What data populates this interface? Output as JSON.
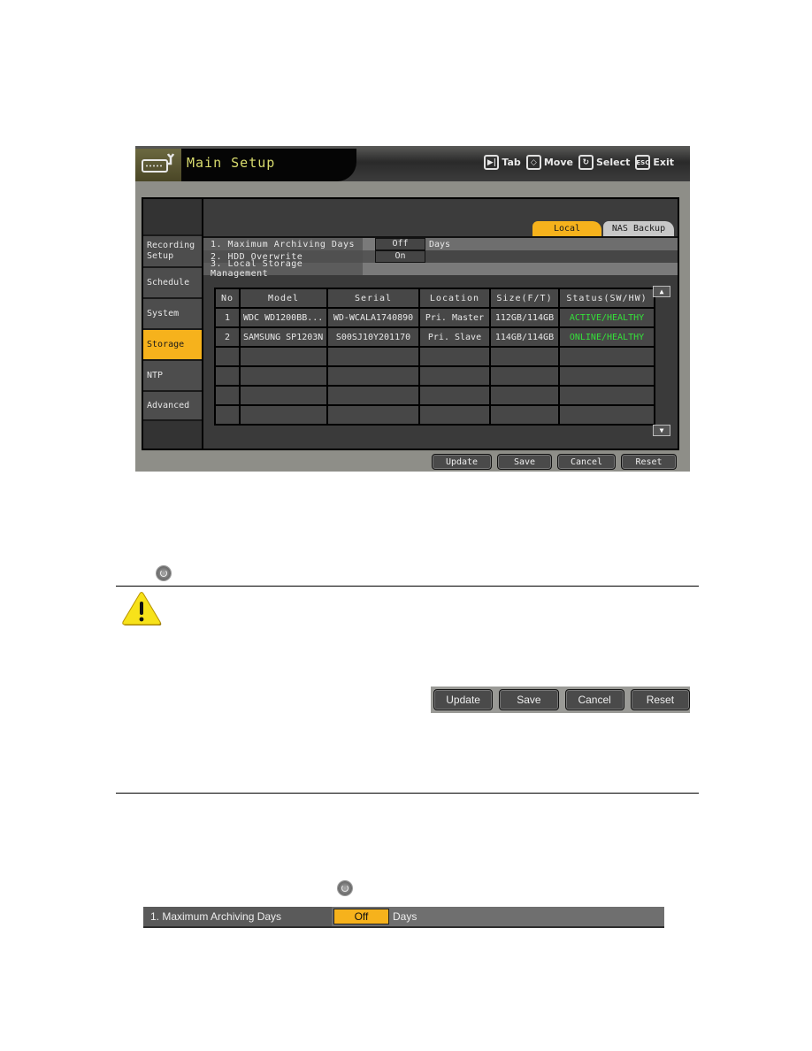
{
  "window": {
    "title": "Main Setup",
    "icon": "setup-wrench-icon"
  },
  "hints": [
    {
      "icon": "tab-icon",
      "key": "▶|",
      "label": "Tab"
    },
    {
      "icon": "move-icon",
      "key": "◇",
      "label": "Move"
    },
    {
      "icon": "select-icon",
      "key": "↻",
      "label": "Select"
    },
    {
      "icon": "esc-icon",
      "key": "ESC",
      "label": "Exit"
    }
  ],
  "sidebar": {
    "items": [
      {
        "label": "Recording Setup",
        "active": false
      },
      {
        "label": "Schedule",
        "active": false
      },
      {
        "label": "System",
        "active": false
      },
      {
        "label": "Storage",
        "active": true
      },
      {
        "label": "NTP",
        "active": false
      },
      {
        "label": "Advanced",
        "active": false
      }
    ]
  },
  "tabs": [
    {
      "label": "Local",
      "active": true
    },
    {
      "label": "NAS Backup",
      "active": false
    }
  ],
  "options": [
    {
      "label": "1. Maximum Archiving Days",
      "value": "Off",
      "unit": "Days"
    },
    {
      "label": "2. HDD Overwrite",
      "value": "On",
      "unit": ""
    },
    {
      "label": "3. Local Storage Management",
      "value": "",
      "unit": ""
    }
  ],
  "table": {
    "headers": [
      "No",
      "Model",
      "Serial",
      "Location",
      "Size(F/T)",
      "Status(SW/HW)"
    ],
    "rows": [
      [
        "1",
        "WDC WD1200BB...",
        "WD-WCALA1740890",
        "Pri. Master",
        "112GB/114GB",
        "ACTIVE/HEALTHY"
      ],
      [
        "2",
        "SAMSUNG SP1203N",
        "S00SJ10Y201170",
        "Pri. Slave",
        "114GB/114GB",
        "ONLINE/HEALTHY"
      ],
      [
        "",
        "",
        "",
        "",
        "",
        ""
      ],
      [
        "",
        "",
        "",
        "",
        "",
        ""
      ],
      [
        "",
        "",
        "",
        "",
        "",
        ""
      ],
      [
        "",
        "",
        "",
        "",
        "",
        ""
      ]
    ],
    "scroll_up": "▲",
    "scroll_down": "▼"
  },
  "buttons": {
    "update": "Update",
    "save": "Save",
    "cancel": "Cancel",
    "reset": "Reset"
  },
  "archive_row": {
    "label": "1. Maximum Archiving Days",
    "value": "Off",
    "unit": "Days"
  },
  "colors": {
    "accent": "#f6b21c",
    "status_ok": "#35e03a",
    "title_text": "#d9dc6e"
  }
}
